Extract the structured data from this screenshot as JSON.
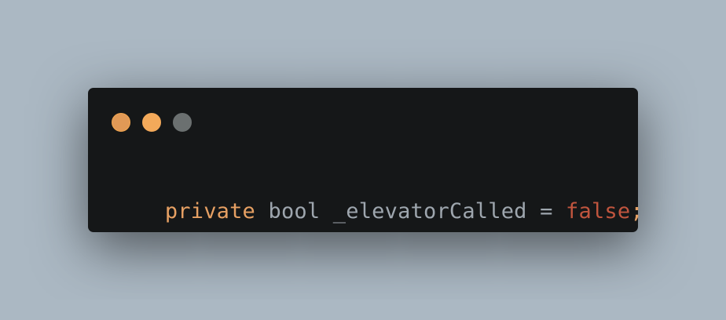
{
  "window": {
    "background": "#151718",
    "controls": [
      {
        "name": "close",
        "color": "#e09956",
        "border": "#f2a64f"
      },
      {
        "name": "minimize",
        "color": "#f3a95a",
        "border": "#f3a95a"
      },
      {
        "name": "zoom",
        "color": "#6b7070",
        "border": "#6b7070"
      }
    ]
  },
  "code": {
    "tokens": [
      {
        "text": "private",
        "kind": "keyword",
        "color": "#e6a063"
      },
      {
        "text": " ",
        "kind": "space",
        "color": "#9ea6ae"
      },
      {
        "text": "bool",
        "kind": "type",
        "color": "#9ea6ae"
      },
      {
        "text": " ",
        "kind": "space",
        "color": "#9ea6ae"
      },
      {
        "text": "_elevatorCalled",
        "kind": "identifier",
        "color": "#9ea6ae"
      },
      {
        "text": " ",
        "kind": "space",
        "color": "#9ea6ae"
      },
      {
        "text": "=",
        "kind": "operator",
        "color": "#9ea6ae"
      },
      {
        "text": " ",
        "kind": "space",
        "color": "#9ea6ae"
      },
      {
        "text": "false",
        "kind": "literal",
        "color": "#c0553e"
      },
      {
        "text": ";",
        "kind": "punctuation",
        "color": "#e6a063"
      }
    ]
  }
}
